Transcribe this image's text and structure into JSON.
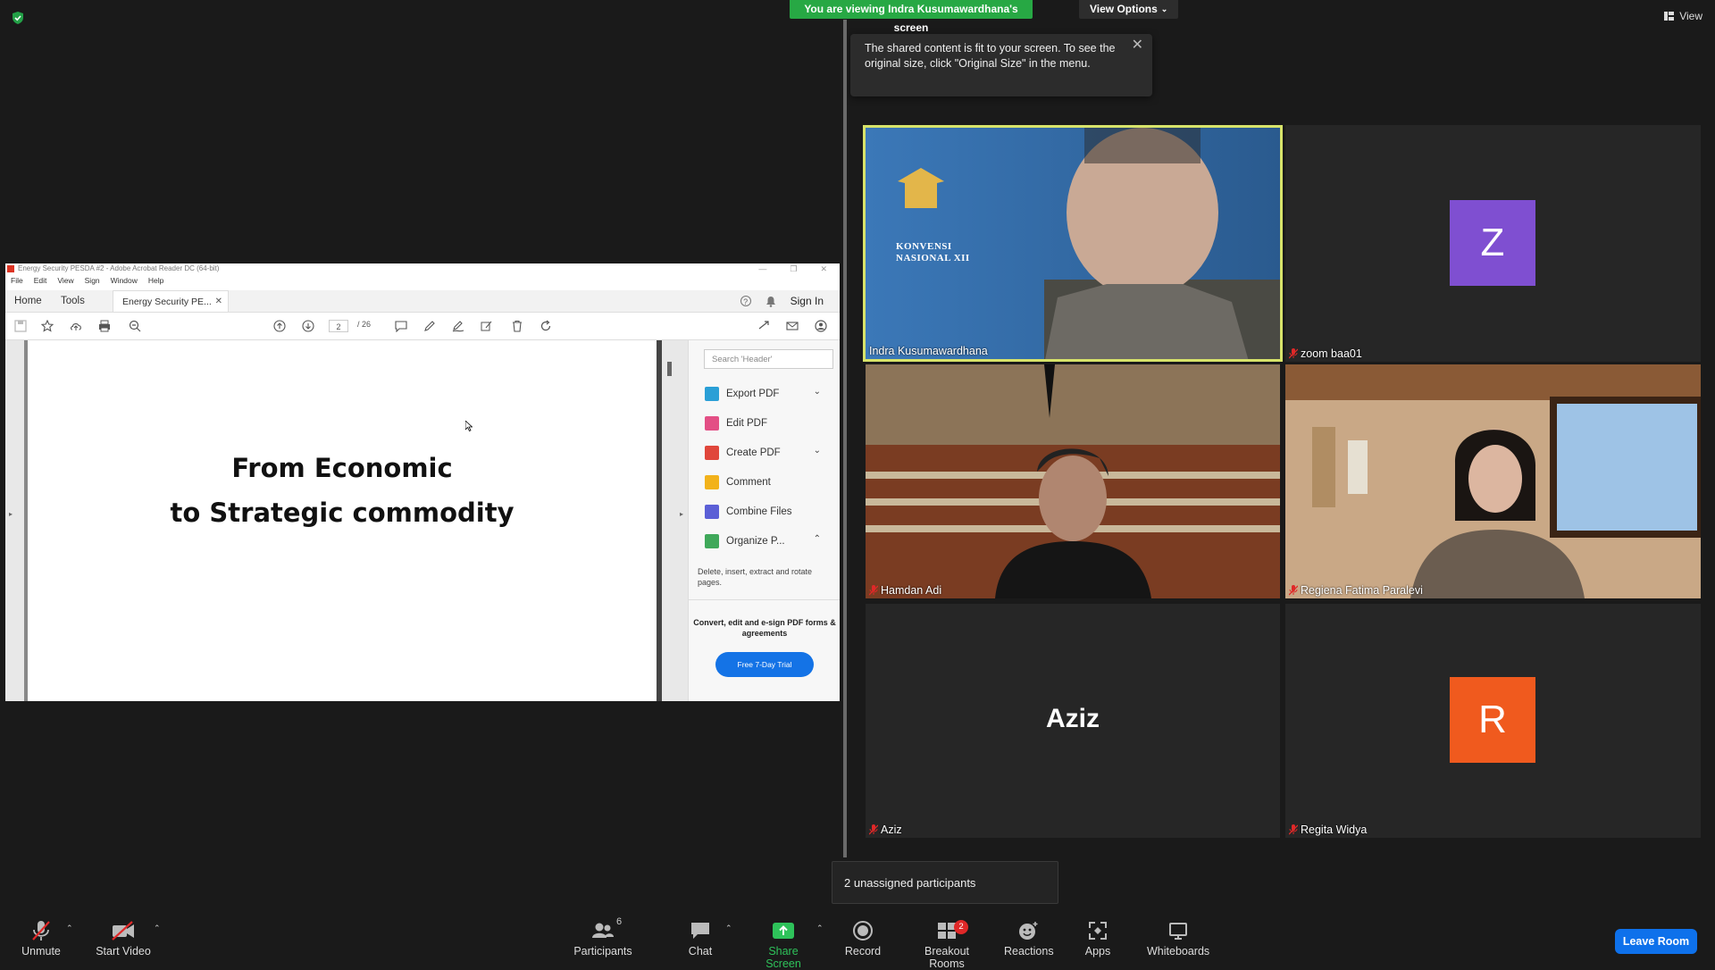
{
  "zoom": {
    "viewing_banner": "You are viewing Indra Kusumawardhana's screen",
    "view_options": "View Options",
    "view_label": "View",
    "tooltip": "The shared content is fit to your screen. To see the original size, click \"Original Size\" in the menu."
  },
  "acrobat": {
    "window_title": "Energy Security PESDA #2 - Adobe Acrobat Reader DC (64-bit)",
    "menu": [
      "File",
      "Edit",
      "View",
      "Sign",
      "Window",
      "Help"
    ],
    "tabs": {
      "home": "Home",
      "tools": "Tools",
      "doc": "Energy Security PE..."
    },
    "sign_in": "Sign In",
    "page_current": "2",
    "page_total": "/ 26",
    "slide_line1": "From Economic",
    "slide_line2": "to Strategic commodity",
    "search_placeholder": "Search 'Header'",
    "panel_items": [
      {
        "label": "Export PDF",
        "color": "#2a9fd6"
      },
      {
        "label": "Edit PDF",
        "color": "#e34f85"
      },
      {
        "label": "Create PDF",
        "color": "#e0463b"
      },
      {
        "label": "Comment",
        "color": "#f2b21b"
      },
      {
        "label": "Combine Files",
        "color": "#5b5fd6"
      },
      {
        "label": "Organize P...",
        "color": "#3fa85a"
      }
    ],
    "panel_desc": "Delete, insert, extract and rotate pages.",
    "promo": "Convert, edit and e-sign PDF forms & agreements",
    "trial_button": "Free 7-Day Trial"
  },
  "participants": [
    {
      "name": "Indra Kusumawardhana",
      "muted": false,
      "video": true,
      "active_speaker": true,
      "banner": "KONVENSI NASIONAL XII"
    },
    {
      "name": "zoom baa01",
      "muted": true,
      "video": false,
      "avatar_letter": "Z",
      "avatar_color": "#7f4fd1"
    },
    {
      "name": "Hamdan Adi",
      "muted": true,
      "video": true
    },
    {
      "name": "Regiena Fatima Paralevi",
      "muted": true,
      "video": true
    },
    {
      "name": "Aziz",
      "muted": true,
      "video": false,
      "display_text": "Aziz"
    },
    {
      "name": "Regita Widya",
      "muted": true,
      "video": false,
      "avatar_letter": "R",
      "avatar_color": "#f05a1e"
    }
  ],
  "breakout_popup": "2 unassigned participants",
  "toolbar": {
    "unmute": "Unmute",
    "start_video": "Start Video",
    "participants": "Participants",
    "participants_count": "6",
    "chat": "Chat",
    "share_screen": "Share Screen",
    "record": "Record",
    "breakout_rooms": "Breakout Rooms",
    "breakout_badge": "2",
    "reactions": "Reactions",
    "apps": "Apps",
    "whiteboards": "Whiteboards",
    "leave_room": "Leave Room"
  },
  "colors": {
    "banner_green": "#27a844",
    "active_speaker_border": "#d7e36a",
    "leave_blue": "#0e71eb",
    "muted_red": "#e02828"
  }
}
